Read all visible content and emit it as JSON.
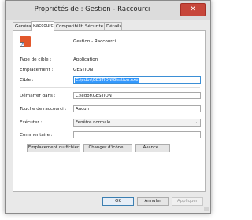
{
  "window": {
    "title": "Propriétés de : Gestion - Raccourci",
    "close_glyph": "✕"
  },
  "tabs": [
    {
      "label": "Général",
      "active": false
    },
    {
      "label": "Raccourci",
      "active": true
    },
    {
      "label": "Compatibilité",
      "active": false
    },
    {
      "label": "Sécurité",
      "active": false
    },
    {
      "label": "Détails",
      "active": false
    }
  ],
  "shortcut": {
    "name": "Gestion - Raccourci",
    "icon": "shortcut-app-icon",
    "icon_color": "#e2572b"
  },
  "info": {
    "type_label": "Type de cible :",
    "type_value": "Application",
    "location_label": "Emplacement :",
    "location_value": "GESTION",
    "target_label": "Cible :",
    "target_value": "C:\\edbr\\GESTION\\Gestion.exe"
  },
  "fields": {
    "start_label": "Démarrer dans :",
    "start_value": "C:\\edbr\\GESTION",
    "hotkey_label": "Touche de raccourci :",
    "hotkey_value": "Aucun",
    "run_label": "Exécuter :",
    "run_value": "Fenêtre normale",
    "comment_label": "Commentaire :",
    "comment_value": ""
  },
  "buttons": {
    "open_location": "Emplacement du fichier",
    "change_icon": "Changer d'icône...",
    "advanced": "Avancé...",
    "ok": "OK",
    "cancel": "Annuler",
    "apply": "Appliquer"
  },
  "colors": {
    "selection": "#3399ff",
    "close_button": "#c7473b"
  }
}
